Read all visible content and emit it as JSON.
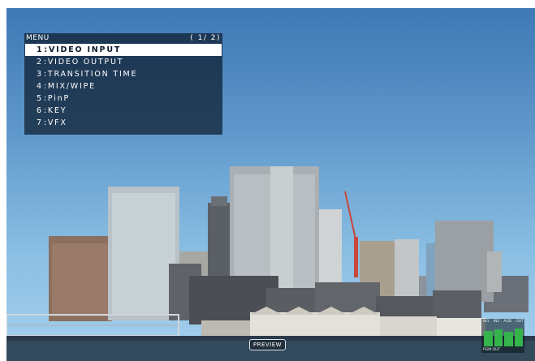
{
  "menu": {
    "title": "MENU",
    "page": "( 1/ 2)",
    "items": [
      {
        "number": "1",
        "label": "VIDEO INPUT",
        "selected": true
      },
      {
        "number": "2",
        "label": "VIDEO OUTPUT",
        "selected": false
      },
      {
        "number": "3",
        "label": "TRANSITION TIME",
        "selected": false
      },
      {
        "number": "4",
        "label": "MIX/WIPE",
        "selected": false
      },
      {
        "number": "5",
        "label": "PinP",
        "selected": false
      },
      {
        "number": "6",
        "label": "KEY",
        "selected": false
      },
      {
        "number": "7",
        "label": "VFX",
        "selected": false
      }
    ]
  },
  "preview": {
    "label": "PREVIEW"
  },
  "audio_meter": {
    "labels": [
      "IN1",
      "IN2",
      "AUD",
      "OUT"
    ],
    "footer": "PGM  OUT",
    "levels": [
      0.75,
      0.82,
      0.7,
      0.86
    ]
  },
  "colors": {
    "sky_top": "#3f78b4",
    "sky_bottom": "#a6d0ee",
    "menu_bg": "#0c1c2d",
    "menu_selected_bg": "#ffffff",
    "meter_green": "#34b44a"
  }
}
